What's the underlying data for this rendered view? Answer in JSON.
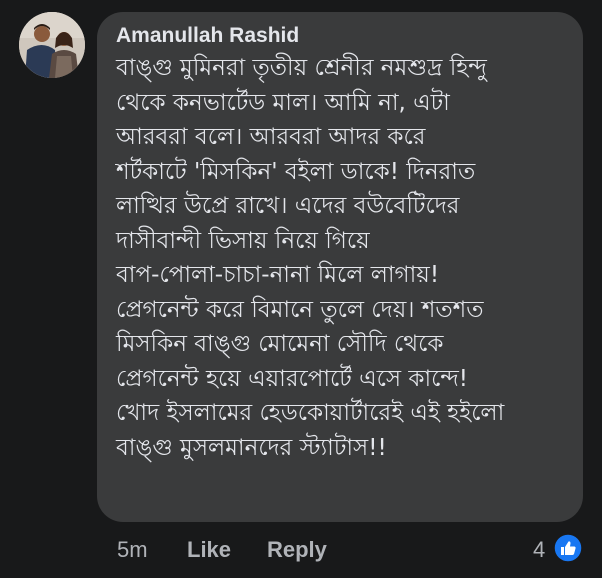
{
  "comment": {
    "author": "Amanullah Rashid",
    "lines": [
      "বাঙ্গু মুমিনরা তৃতীয় শ্রেনীর নমশুদ্র হিন্দু",
      "থেকে কনভার্টেড মাল। আমি না, এটা",
      "আরবরা বলে। আরবরা আদর করে",
      "শর্টকাটে 'মিসকিন' বইলা ডাকে! দিনরাত",
      "লাত্থির উপ্রে রাখে। এদের বউবেটিদের",
      "দাসীবান্দী ভিসায় নিয়ে গিয়ে",
      "বাপ-পোলা-চাচা-নানা মিলে লাগায়!",
      "প্রেগনেন্ট করে বিমানে তুলে দেয়। শতশত",
      "মিসকিন বাঙ্গু মোমেনা সৌদি থেকে",
      "প্রেগনেন্ট হয়ে এয়ারপোর্টে এসে কান্দে!",
      "খোদ ইসলামের হেডকোয়ার্টারেই এই হইলো",
      "বাঙ্গু মুসলমানদের স্ট্যাটাস!!"
    ]
  },
  "footer": {
    "time": "5m",
    "like_label": "Like",
    "reply_label": "Reply",
    "reaction_count": "4",
    "reaction_icon": "thumbs-up-icon"
  },
  "colors": {
    "background": "#18191a",
    "bubble": "#3a3b3c",
    "text": "#e4e6eb",
    "muted": "#b0b3b8",
    "like_blue": "#1877f2"
  }
}
